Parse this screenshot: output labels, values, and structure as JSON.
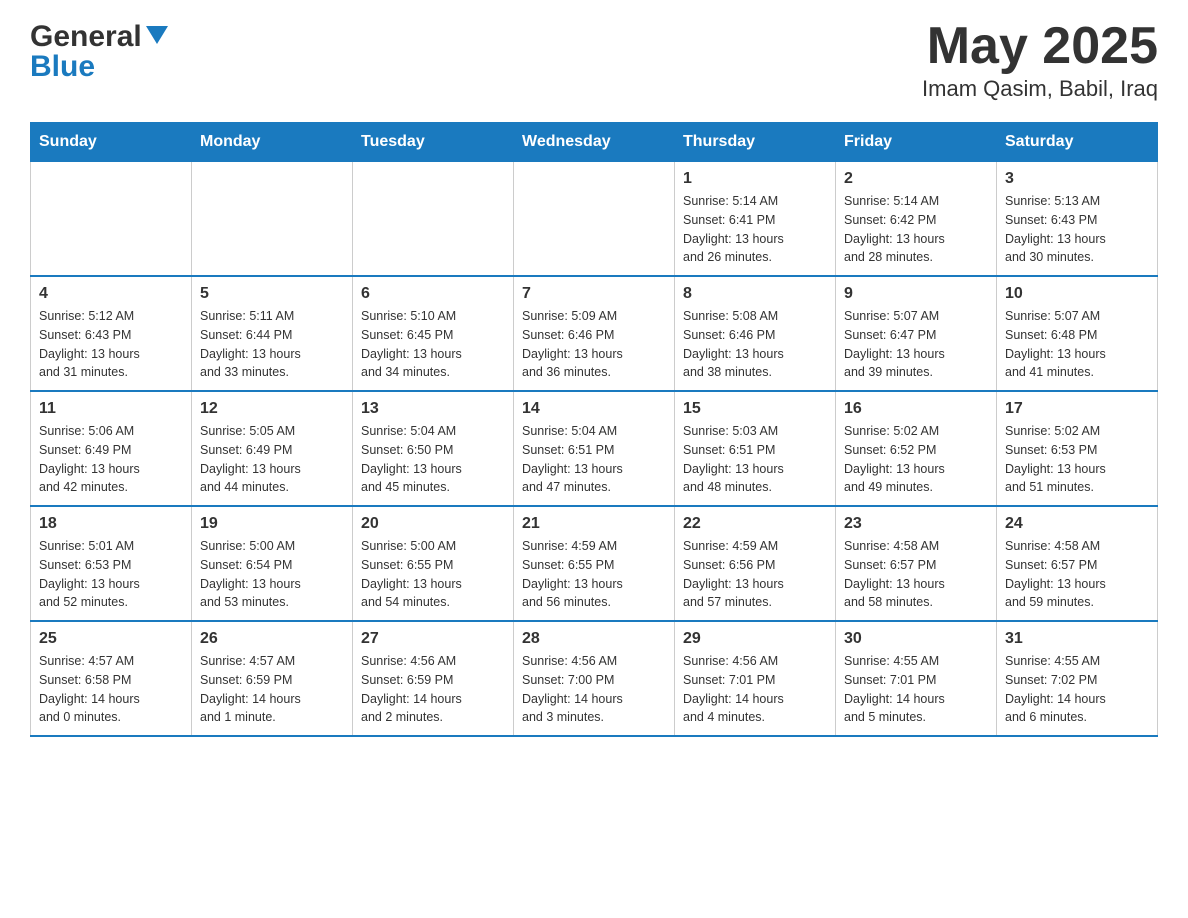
{
  "header": {
    "logo": {
      "general": "General",
      "blue": "Blue"
    },
    "month": "May 2025",
    "location": "Imam Qasim, Babil, Iraq"
  },
  "weekdays": [
    "Sunday",
    "Monday",
    "Tuesday",
    "Wednesday",
    "Thursday",
    "Friday",
    "Saturday"
  ],
  "weeks": [
    [
      {
        "day": "",
        "info": ""
      },
      {
        "day": "",
        "info": ""
      },
      {
        "day": "",
        "info": ""
      },
      {
        "day": "",
        "info": ""
      },
      {
        "day": "1",
        "info": "Sunrise: 5:14 AM\nSunset: 6:41 PM\nDaylight: 13 hours\nand 26 minutes."
      },
      {
        "day": "2",
        "info": "Sunrise: 5:14 AM\nSunset: 6:42 PM\nDaylight: 13 hours\nand 28 minutes."
      },
      {
        "day": "3",
        "info": "Sunrise: 5:13 AM\nSunset: 6:43 PM\nDaylight: 13 hours\nand 30 minutes."
      }
    ],
    [
      {
        "day": "4",
        "info": "Sunrise: 5:12 AM\nSunset: 6:43 PM\nDaylight: 13 hours\nand 31 minutes."
      },
      {
        "day": "5",
        "info": "Sunrise: 5:11 AM\nSunset: 6:44 PM\nDaylight: 13 hours\nand 33 minutes."
      },
      {
        "day": "6",
        "info": "Sunrise: 5:10 AM\nSunset: 6:45 PM\nDaylight: 13 hours\nand 34 minutes."
      },
      {
        "day": "7",
        "info": "Sunrise: 5:09 AM\nSunset: 6:46 PM\nDaylight: 13 hours\nand 36 minutes."
      },
      {
        "day": "8",
        "info": "Sunrise: 5:08 AM\nSunset: 6:46 PM\nDaylight: 13 hours\nand 38 minutes."
      },
      {
        "day": "9",
        "info": "Sunrise: 5:07 AM\nSunset: 6:47 PM\nDaylight: 13 hours\nand 39 minutes."
      },
      {
        "day": "10",
        "info": "Sunrise: 5:07 AM\nSunset: 6:48 PM\nDaylight: 13 hours\nand 41 minutes."
      }
    ],
    [
      {
        "day": "11",
        "info": "Sunrise: 5:06 AM\nSunset: 6:49 PM\nDaylight: 13 hours\nand 42 minutes."
      },
      {
        "day": "12",
        "info": "Sunrise: 5:05 AM\nSunset: 6:49 PM\nDaylight: 13 hours\nand 44 minutes."
      },
      {
        "day": "13",
        "info": "Sunrise: 5:04 AM\nSunset: 6:50 PM\nDaylight: 13 hours\nand 45 minutes."
      },
      {
        "day": "14",
        "info": "Sunrise: 5:04 AM\nSunset: 6:51 PM\nDaylight: 13 hours\nand 47 minutes."
      },
      {
        "day": "15",
        "info": "Sunrise: 5:03 AM\nSunset: 6:51 PM\nDaylight: 13 hours\nand 48 minutes."
      },
      {
        "day": "16",
        "info": "Sunrise: 5:02 AM\nSunset: 6:52 PM\nDaylight: 13 hours\nand 49 minutes."
      },
      {
        "day": "17",
        "info": "Sunrise: 5:02 AM\nSunset: 6:53 PM\nDaylight: 13 hours\nand 51 minutes."
      }
    ],
    [
      {
        "day": "18",
        "info": "Sunrise: 5:01 AM\nSunset: 6:53 PM\nDaylight: 13 hours\nand 52 minutes."
      },
      {
        "day": "19",
        "info": "Sunrise: 5:00 AM\nSunset: 6:54 PM\nDaylight: 13 hours\nand 53 minutes."
      },
      {
        "day": "20",
        "info": "Sunrise: 5:00 AM\nSunset: 6:55 PM\nDaylight: 13 hours\nand 54 minutes."
      },
      {
        "day": "21",
        "info": "Sunrise: 4:59 AM\nSunset: 6:55 PM\nDaylight: 13 hours\nand 56 minutes."
      },
      {
        "day": "22",
        "info": "Sunrise: 4:59 AM\nSunset: 6:56 PM\nDaylight: 13 hours\nand 57 minutes."
      },
      {
        "day": "23",
        "info": "Sunrise: 4:58 AM\nSunset: 6:57 PM\nDaylight: 13 hours\nand 58 minutes."
      },
      {
        "day": "24",
        "info": "Sunrise: 4:58 AM\nSunset: 6:57 PM\nDaylight: 13 hours\nand 59 minutes."
      }
    ],
    [
      {
        "day": "25",
        "info": "Sunrise: 4:57 AM\nSunset: 6:58 PM\nDaylight: 14 hours\nand 0 minutes."
      },
      {
        "day": "26",
        "info": "Sunrise: 4:57 AM\nSunset: 6:59 PM\nDaylight: 14 hours\nand 1 minute."
      },
      {
        "day": "27",
        "info": "Sunrise: 4:56 AM\nSunset: 6:59 PM\nDaylight: 14 hours\nand 2 minutes."
      },
      {
        "day": "28",
        "info": "Sunrise: 4:56 AM\nSunset: 7:00 PM\nDaylight: 14 hours\nand 3 minutes."
      },
      {
        "day": "29",
        "info": "Sunrise: 4:56 AM\nSunset: 7:01 PM\nDaylight: 14 hours\nand 4 minutes."
      },
      {
        "day": "30",
        "info": "Sunrise: 4:55 AM\nSunset: 7:01 PM\nDaylight: 14 hours\nand 5 minutes."
      },
      {
        "day": "31",
        "info": "Sunrise: 4:55 AM\nSunset: 7:02 PM\nDaylight: 14 hours\nand 6 minutes."
      }
    ]
  ]
}
